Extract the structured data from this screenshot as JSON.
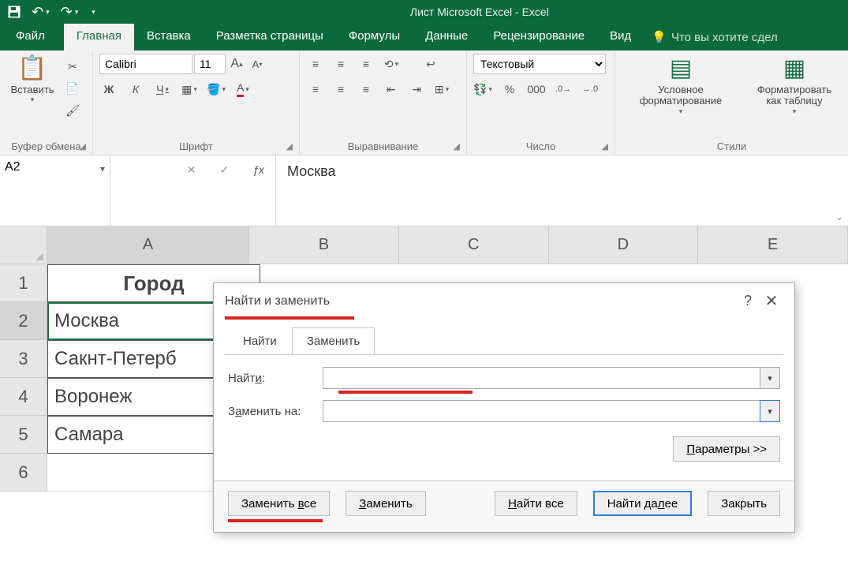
{
  "app": {
    "title": "Лист Microsoft Excel - Excel"
  },
  "tabs": {
    "file": "Файл",
    "home": "Главная",
    "insert": "Вставка",
    "pagelayout": "Разметка страницы",
    "formulas": "Формулы",
    "data": "Данные",
    "review": "Рецензирование",
    "view": "Вид",
    "tellme": "Что вы хотите сдел"
  },
  "ribbon": {
    "clipboard": {
      "paste": "Вставить",
      "group": "Буфер обмена"
    },
    "font": {
      "name": "Calibri",
      "size": "11",
      "bold": "Ж",
      "italic": "К",
      "underline": "Ч",
      "group": "Шрифт"
    },
    "alignment": {
      "group": "Выравнивание"
    },
    "number": {
      "format": "Текстовый",
      "percent": "%",
      "thousands": "000",
      "group": "Число"
    },
    "styles": {
      "cond": "Условное форматирование",
      "table": "Форматировать как таблицу",
      "group": "Стили"
    }
  },
  "formula_bar": {
    "name_box": "A2",
    "fx_value": "Москва"
  },
  "sheet": {
    "columns": [
      "A",
      "B",
      "C",
      "D",
      "E"
    ],
    "rows": [
      "1",
      "2",
      "3",
      "4",
      "5",
      "6"
    ],
    "a": {
      "r1": "Город",
      "r2": "Москва",
      "r3": "Сакнт-Петерб",
      "r4": "Воронеж",
      "r5": "Самара"
    }
  },
  "dialog": {
    "title": "Найти и заменить",
    "tab_find": "Найти",
    "tab_replace": "Заменить",
    "label_find": "Найти:",
    "label_replace": "Заменить на:",
    "find_value": "",
    "replace_value": "",
    "params": "Параметры >>",
    "btn_replace_all": "Заменить все",
    "btn_replace": "Заменить",
    "btn_find_all": "Найти все",
    "btn_find_next": "Найти далее",
    "btn_close": "Закрыть"
  }
}
